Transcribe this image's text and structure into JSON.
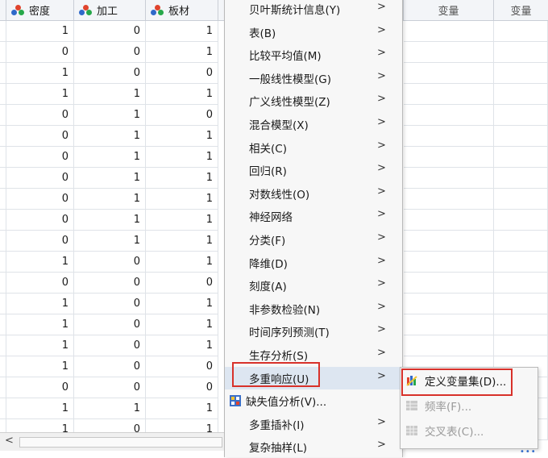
{
  "columns": [
    {
      "name": "密度",
      "icon": "nominal-measure-icon"
    },
    {
      "name": "加工",
      "icon": "nominal-measure-icon"
    },
    {
      "name": "板材",
      "icon": "nominal-measure-icon"
    }
  ],
  "var_headers": [
    "变量",
    "变量"
  ],
  "rows": [
    [
      "1",
      "0",
      "1"
    ],
    [
      "0",
      "0",
      "1"
    ],
    [
      "1",
      "0",
      "0"
    ],
    [
      "1",
      "1",
      "1"
    ],
    [
      "0",
      "1",
      "0"
    ],
    [
      "0",
      "1",
      "1"
    ],
    [
      "0",
      "1",
      "1"
    ],
    [
      "0",
      "1",
      "1"
    ],
    [
      "0",
      "1",
      "1"
    ],
    [
      "0",
      "1",
      "1"
    ],
    [
      "0",
      "1",
      "1"
    ],
    [
      "1",
      "0",
      "1"
    ],
    [
      "0",
      "0",
      "0"
    ],
    [
      "1",
      "0",
      "1"
    ],
    [
      "1",
      "0",
      "1"
    ],
    [
      "1",
      "0",
      "1"
    ],
    [
      "1",
      "0",
      "0"
    ],
    [
      "0",
      "0",
      "0"
    ],
    [
      "1",
      "1",
      "1"
    ],
    [
      "1",
      "0",
      "1"
    ]
  ],
  "scroll_left_arrow": "<",
  "menu": {
    "items": [
      {
        "label": "贝叶斯统计信息(Y)",
        "submenu": true
      },
      {
        "label": "表(B)",
        "submenu": true
      },
      {
        "label": "比较平均值(M)",
        "submenu": true
      },
      {
        "label": "一般线性模型(G)",
        "submenu": true
      },
      {
        "label": "广义线性模型(Z)",
        "submenu": true
      },
      {
        "label": "混合模型(X)",
        "submenu": true
      },
      {
        "label": "相关(C)",
        "submenu": true
      },
      {
        "label": "回归(R)",
        "submenu": true
      },
      {
        "label": "对数线性(O)",
        "submenu": true
      },
      {
        "label": "神经网络",
        "submenu": true
      },
      {
        "label": "分类(F)",
        "submenu": true
      },
      {
        "label": "降维(D)",
        "submenu": true
      },
      {
        "label": "刻度(A)",
        "submenu": true
      },
      {
        "label": "非参数检验(N)",
        "submenu": true
      },
      {
        "label": "时间序列预测(T)",
        "submenu": true
      },
      {
        "label": "生存分析(S)",
        "submenu": true
      },
      {
        "label": "多重响应(U)",
        "submenu": true,
        "highlighted": true
      },
      {
        "label": "缺失值分析(V)...",
        "submenu": false,
        "icon": "missing-value-icon"
      },
      {
        "label": "多重插补(I)",
        "submenu": true
      },
      {
        "label": "复杂抽样(L)",
        "submenu": true
      }
    ],
    "chevron": ">"
  },
  "submenu": {
    "items": [
      {
        "label": "定义变量集(D)...",
        "enabled": true,
        "icon": "define-set-icon"
      },
      {
        "label": "频率(F)...",
        "enabled": false,
        "icon": "frequency-table-icon"
      },
      {
        "label": "交叉表(C)...",
        "enabled": false,
        "icon": "crosstab-icon"
      }
    ]
  },
  "colors": {
    "highlight_box": "#d8312a",
    "menu_bg": "#f7f7f7",
    "selected_row": "#dde6f1"
  }
}
